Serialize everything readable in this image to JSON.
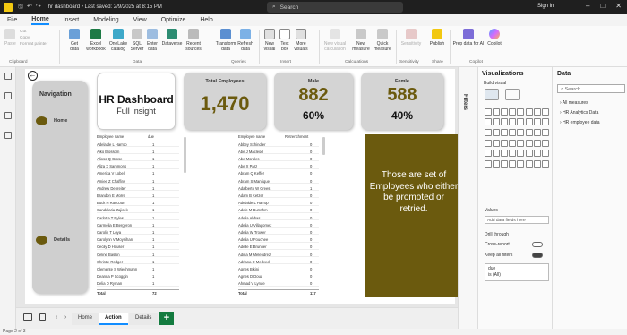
{
  "titlebar": {
    "doc_title": "hr dashboard • Last saved: 2/9/2025 at 8:15 PM",
    "search_placeholder": "Search",
    "signin": "Sign in"
  },
  "menu": [
    "File",
    "Home",
    "Insert",
    "Modeling",
    "View",
    "Optimize",
    "Help"
  ],
  "ribbon": {
    "clipboard": {
      "paste": "Paste",
      "cut": "Cut",
      "copy": "Copy",
      "format_painter": "Format painter",
      "label": "Clipboard"
    },
    "data": {
      "get_data": "Get data",
      "excel": "Excel workbook",
      "onelake": "OneLake catalog",
      "sql": "SQL Server",
      "enter": "Enter data",
      "dataverse": "Dataverse",
      "recent": "Recent sources",
      "label": "Data"
    },
    "queries": {
      "transform": "Transform data",
      "refresh": "Refresh data",
      "label": "Queries"
    },
    "insert": {
      "new_visual": "New visual",
      "text_box": "Text box",
      "more_visuals": "More visuals",
      "label": "Insert"
    },
    "calculations": {
      "new_visual_calc": "New visual calculation",
      "new_measure": "New measure",
      "quick_measure": "Quick measure",
      "label": "Calculations"
    },
    "sensitivity": {
      "btn": "Sensitivity",
      "label": "Sensitivity"
    },
    "share": {
      "publish": "Publish",
      "label": "Share"
    },
    "copilot": {
      "prep": "Prep data for AI",
      "copilot": "Copilot",
      "label": "Copilot"
    }
  },
  "report": {
    "navigation": {
      "title": "Navigation",
      "home": "Home",
      "details": "Details"
    },
    "hr_card": {
      "title": "HR Dashboard",
      "subtitle": "Full Insight"
    },
    "total": {
      "title": "Total Employees",
      "value": "1,470"
    },
    "male": {
      "title": "Male",
      "value": "882",
      "pct": "60%"
    },
    "female": {
      "title": "Femle",
      "value": "588",
      "pct": "40%"
    },
    "table1": {
      "col1": "Employee name",
      "col2": "due",
      "rows": [
        [
          "Adelaide L Harrop",
          "1"
        ],
        [
          "Aiko Blossom",
          "1"
        ],
        [
          "Alioso Q Grose",
          "1"
        ],
        [
          "Aliza X Sammons",
          "1"
        ],
        [
          "America V Lobel",
          "1"
        ],
        [
          "Amiee Z Chaffins",
          "1"
        ],
        [
          "Andrew Dehreiter",
          "1"
        ],
        [
          "Brandon E Morre",
          "1"
        ],
        [
          "Buck H Rancourt",
          "1"
        ],
        [
          "Candelaria Zajicek",
          "1"
        ],
        [
          "Carlotta T Ryles",
          "1"
        ],
        [
          "Carmelia E Bergeron",
          "1"
        ],
        [
          "Carolin T Loya",
          "1"
        ],
        [
          "Carolynn V Moynihan",
          "1"
        ],
        [
          "Cecily D Houser",
          "1"
        ],
        [
          "Celine Baskin",
          "1"
        ],
        [
          "Christie Rodger",
          "1"
        ],
        [
          "Clemente S Wiechmann",
          "1"
        ],
        [
          "Deanna P Scoggin",
          "1"
        ],
        [
          "Delia D Ryman",
          "1"
        ]
      ],
      "total_label": "Total",
      "total_value": "72"
    },
    "table2": {
      "col1": "Employee name",
      "col2": "Retrenchment",
      "rows": [
        [
          "Abbey Schindler",
          "0"
        ],
        [
          "Abe J Macleod",
          "0"
        ],
        [
          "Abe Morales",
          "0"
        ],
        [
          "Abe X Parz",
          "0"
        ],
        [
          "Abram Q Keffer",
          "0"
        ],
        [
          "Abram S Manrique",
          "0"
        ],
        [
          "Adalberto W Crees",
          "1"
        ],
        [
          "Adam B Ketzer",
          "0"
        ],
        [
          "Adelaide L Harrop",
          "0"
        ],
        [
          "Adele M Burrahm",
          "0"
        ],
        [
          "Adelia Abbas",
          "0"
        ],
        [
          "Adelia U Villagomez",
          "0"
        ],
        [
          "Adelia W Trower",
          "0"
        ],
        [
          "Adelia U Fouchee",
          "0"
        ],
        [
          "Adelle E Brunner",
          "0"
        ],
        [
          "Adina M Melendrez",
          "0"
        ],
        [
          "Adriana D Medved",
          "0"
        ],
        [
          "Agnes Bikini",
          "0"
        ],
        [
          "Agnes D Doud",
          "0"
        ],
        [
          "Ahmad V Lynde",
          "0"
        ]
      ],
      "total_label": "Total",
      "total_value": "117"
    },
    "note": "Those are set of Employees who either be promoted or retried."
  },
  "filters_label": "Filters",
  "visualizations": {
    "title": "Visualizations",
    "build_visual": "Build visual",
    "values_label": "Values",
    "values_placeholder": "Add data fields here",
    "drill_through": "Drill through",
    "cross_report": "Cross-report",
    "cross_report_state": "Off",
    "keep_filters": "Keep all filters",
    "keep_filters_state": "On",
    "filter_field": "due",
    "filter_value": "is (All)"
  },
  "data_pane": {
    "title": "Data",
    "search_placeholder": "Search",
    "items": [
      "All measures",
      "HR Analytics Data",
      "HR employee data"
    ]
  },
  "tabs": {
    "items": [
      "Home",
      "Action",
      "Details"
    ],
    "active": "Action",
    "add": "+"
  },
  "status": {
    "page": "Page 2 of 3"
  },
  "colors": {
    "accent": "#6b5a0e",
    "brand": "#f2c811",
    "active_tab": "#118dff",
    "add_tab": "#137b3f"
  }
}
